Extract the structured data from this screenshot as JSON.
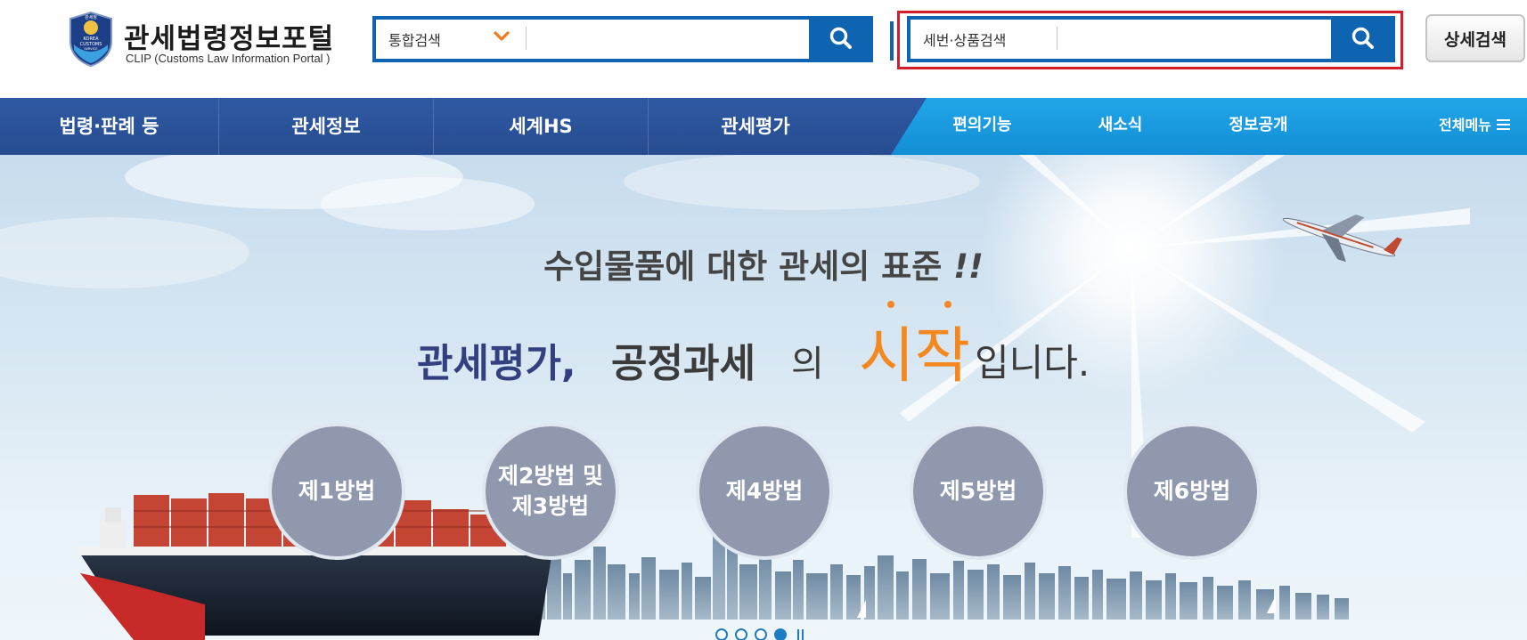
{
  "header": {
    "logo_title": "관세법령정보포털",
    "logo_subtitle": "CLIP (Customs Law Information Portal )",
    "emblem_lines": [
      "관세청",
      "KOREA",
      "CUSTOMS",
      "SERVICE"
    ]
  },
  "search_main": {
    "type_label": "통합검색",
    "value": "",
    "icon": "search-icon",
    "dropdown_icon": "chevron-down-icon"
  },
  "search_tariff": {
    "type_label": "세번·상품검색",
    "value": "",
    "icon": "search-icon"
  },
  "detail_search_label": "상세검색",
  "nav": {
    "main_items": [
      "법령·판례 등",
      "관세정보",
      "세계HS",
      "관세평가"
    ],
    "sub_items": [
      "편의기능",
      "새소식",
      "정보공개"
    ],
    "all_menu_label": "전체메뉴",
    "all_menu_icon": "hamburger-icon"
  },
  "banner": {
    "headline": "수입물품에 대한 관세의 표준",
    "headline_emphasis": "!!",
    "tagline_part1": "관세평가,",
    "tagline_part2": "공정과세",
    "tagline_part3": "의",
    "tagline_highlight": "시작",
    "tagline_part4": "입니다.",
    "methods": [
      {
        "label_line1": "제1방법",
        "label_line2": ""
      },
      {
        "label_line1": "제2방법 및",
        "label_line2": "제3방법"
      },
      {
        "label_line1": "제4방법",
        "label_line2": ""
      },
      {
        "label_line1": "제5방법",
        "label_line2": ""
      },
      {
        "label_line1": "제6방법",
        "label_line2": ""
      }
    ],
    "slides_total": 4,
    "slide_active": 4,
    "pause_icon": "pause-icon"
  },
  "colors": {
    "brand_blue": "#0f64b1",
    "nav_blue": "#2f5aa3",
    "sub_nav_blue": "#1d9ae0",
    "highlight_orange": "#f5871f",
    "focus_red": "#d41c2c",
    "method_circle": "#8f98ac"
  }
}
